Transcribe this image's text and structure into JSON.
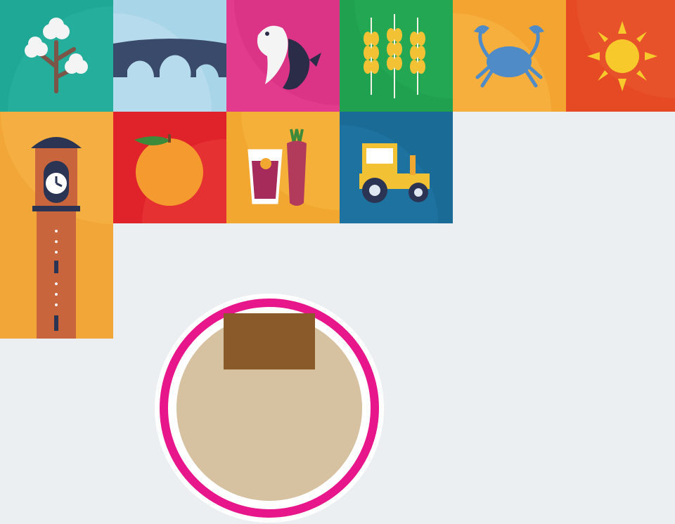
{
  "colors": {
    "page_background": "#eceff2",
    "teal": "#1fa896",
    "sky": "#a9d5e8",
    "magenta": "#e23a8c",
    "green": "#20a14f",
    "amber": "#f3a431",
    "vermilion": "#e54a24",
    "red": "#e0232b",
    "blue": "#1b6b97"
  },
  "tiles": [
    {
      "icon": "cotton-plant-icon"
    },
    {
      "icon": "arch-bridge-icon"
    },
    {
      "icon": "fish-pair-icon"
    },
    {
      "icon": "wheat-stalks-icon"
    },
    {
      "icon": "crab-icon"
    },
    {
      "icon": "sun-icon"
    },
    {
      "icon": "clock-tower-icon"
    },
    {
      "icon": "orange-fruit-icon"
    },
    {
      "icon": "juice-and-carrot-icon"
    },
    {
      "icon": "tractor-icon"
    }
  ],
  "profile_avatar": {
    "ring_colors": [
      "#e8168b",
      "#c2167a"
    ]
  }
}
